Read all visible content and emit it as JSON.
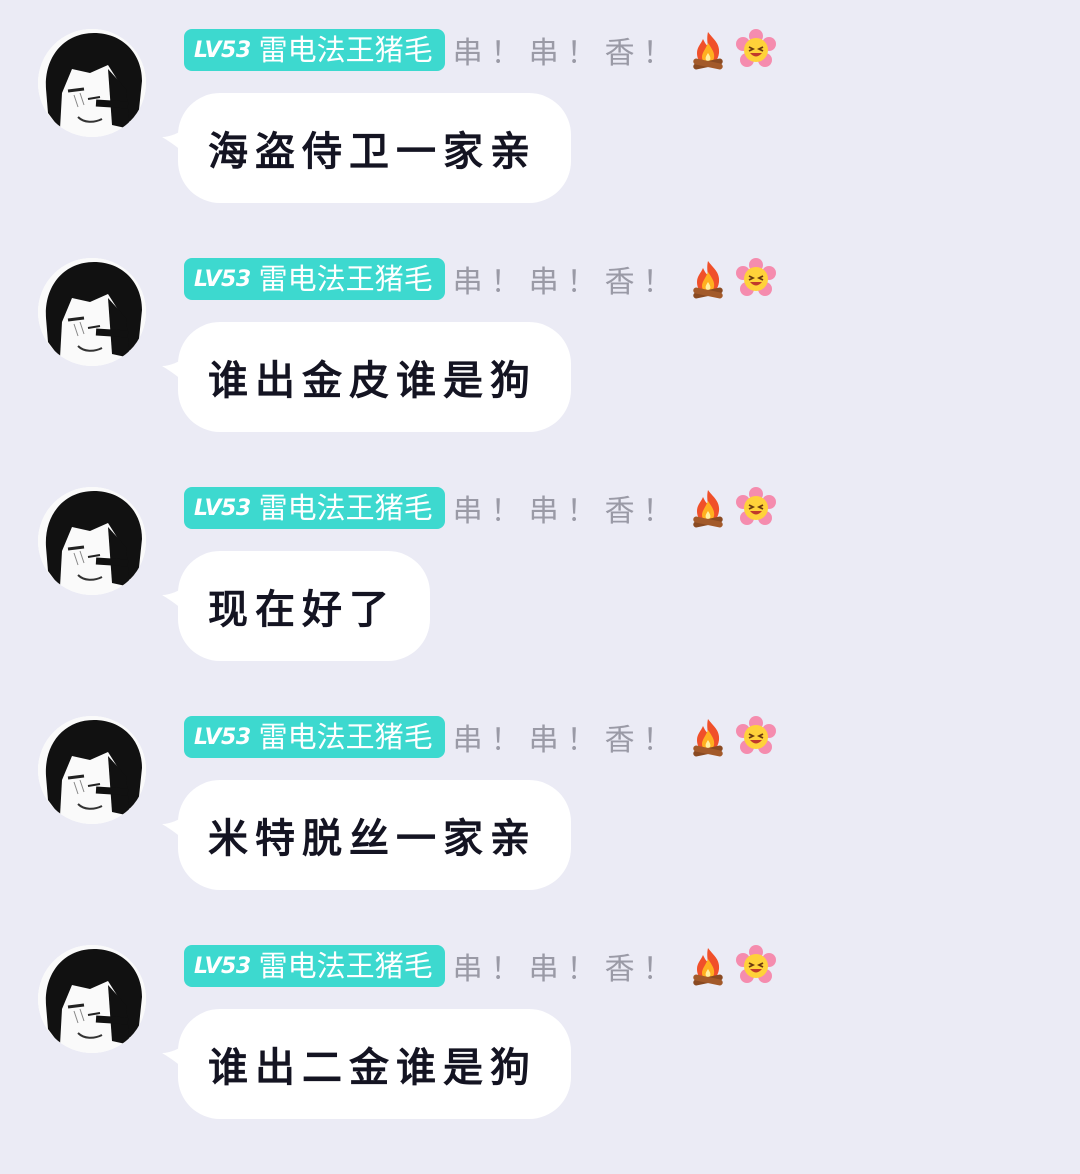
{
  "messages": [
    {
      "level": "LV53",
      "username": "雷电法王猪毛",
      "signature": "串！串！香！",
      "text": "海盗侍卫一家亲"
    },
    {
      "level": "LV53",
      "username": "雷电法王猪毛",
      "signature": "串！串！香！",
      "text": "谁出金皮谁是狗"
    },
    {
      "level": "LV53",
      "username": "雷电法王猪毛",
      "signature": "串！串！香！",
      "text": "现在好了"
    },
    {
      "level": "LV53",
      "username": "雷电法王猪毛",
      "signature": "串！串！香！",
      "text": "米特脱丝一家亲"
    },
    {
      "level": "LV53",
      "username": "雷电法王猪毛",
      "signature": "串！串！香！",
      "text": "谁出二金谁是狗"
    }
  ],
  "icons": {
    "avatar": "anime-avatar",
    "emoji_1": "campfire-icon",
    "emoji_2": "laughing-flower-icon"
  },
  "colors": {
    "background": "#ebebf5",
    "badge": "#3dd9cf",
    "bubble": "#ffffff",
    "signature": "#9a9aa6"
  }
}
